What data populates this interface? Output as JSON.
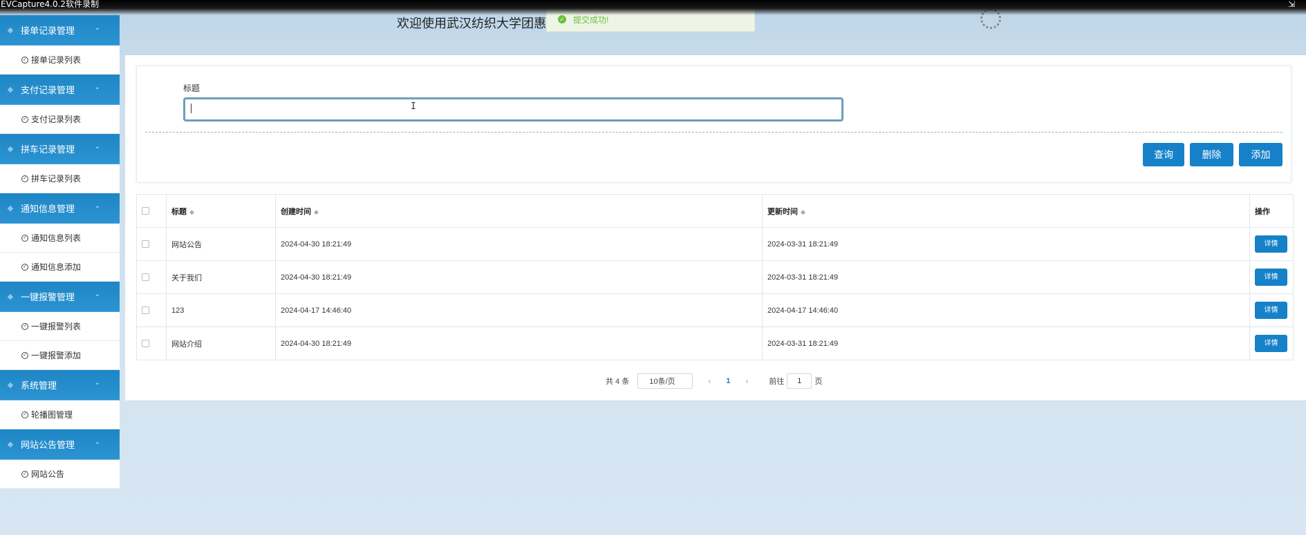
{
  "recorder": {
    "title": "EVCapture4.0.2软件录制",
    "icon": "expand-icon"
  },
  "header": {
    "welcome": "欢迎使用武汉纺织大学团惠打",
    "toast": "提交成功!"
  },
  "sidebar": {
    "groups": [
      {
        "label": "接单记录管理",
        "items": [
          "接单记录列表"
        ]
      },
      {
        "label": "支付记录管理",
        "items": [
          "支付记录列表"
        ]
      },
      {
        "label": "拼车记录管理",
        "items": [
          "拼车记录列表"
        ]
      },
      {
        "label": "通知信息管理",
        "items": [
          "通知信息列表",
          "通知信息添加"
        ]
      },
      {
        "label": "一键报警管理",
        "items": [
          "一键报警列表",
          "一键报警添加"
        ]
      },
      {
        "label": "系统管理",
        "items": [
          "轮播图管理"
        ]
      },
      {
        "label": "网站公告管理",
        "items": [
          "网站公告"
        ]
      }
    ]
  },
  "search": {
    "label": "标题",
    "value": ""
  },
  "buttons": {
    "query": "查询",
    "delete": "删除",
    "add": "添加"
  },
  "table": {
    "headers": {
      "title": "标题",
      "created": "创建时间",
      "updated": "更新时间",
      "actions": "操作"
    },
    "rows": [
      {
        "title": "网站公告",
        "created": "2024-04-30 18:21:49",
        "updated": "2024-03-31 18:21:49",
        "action": "详情"
      },
      {
        "title": "关于我们",
        "created": "2024-04-30 18:21:49",
        "updated": "2024-03-31 18:21:49",
        "action": "详情"
      },
      {
        "title": "123",
        "created": "2024-04-17 14:46:40",
        "updated": "2024-04-17 14:46:40",
        "action": "详情"
      },
      {
        "title": "网站介绍",
        "created": "2024-04-30 18:21:49",
        "updated": "2024-03-31 18:21:49",
        "action": "详情"
      }
    ]
  },
  "pagination": {
    "total": "共 4 条",
    "page_size": "10条/页",
    "prev": "‹",
    "current": "1",
    "next": "›",
    "goto_label": "前往",
    "goto_value": "1",
    "goto_suffix": "页"
  },
  "colors": {
    "primary": "#1681c9",
    "sidebar_group": "#1f86c6",
    "success": "#67c23a"
  }
}
